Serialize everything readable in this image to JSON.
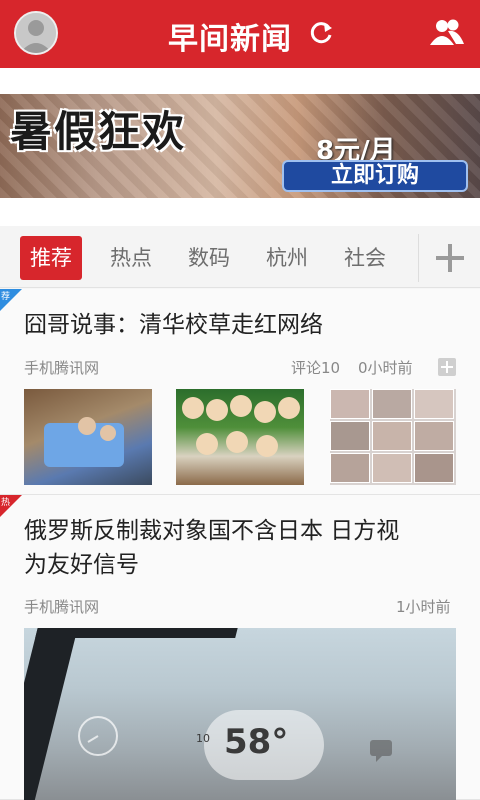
{
  "header": {
    "title": "早间新闻"
  },
  "banner": {
    "title": "暑假狂欢",
    "price": "8元/月",
    "cta": "立即订购"
  },
  "tabs": [
    {
      "label": "推荐",
      "active": true
    },
    {
      "label": "热点"
    },
    {
      "label": "数码"
    },
    {
      "label": "杭州"
    },
    {
      "label": "社会"
    }
  ],
  "articles": [
    {
      "corner": "荐",
      "title": "囧哥说事：清华校草走红网络",
      "source": "手机腾讯网",
      "comments": "评论10",
      "time": "0小时前"
    },
    {
      "corner": "热",
      "title_line1": "俄罗斯反制裁对象国不含日本 日方视",
      "title_line2": "为友好信号",
      "source": "手机腾讯网",
      "time": "1小时前",
      "weather_temp": "58°",
      "weather_small": "10"
    }
  ],
  "colors": {
    "brand": "#d7262c",
    "recommend_corner": "#2f8de0",
    "hot_corner": "#d7262c"
  }
}
